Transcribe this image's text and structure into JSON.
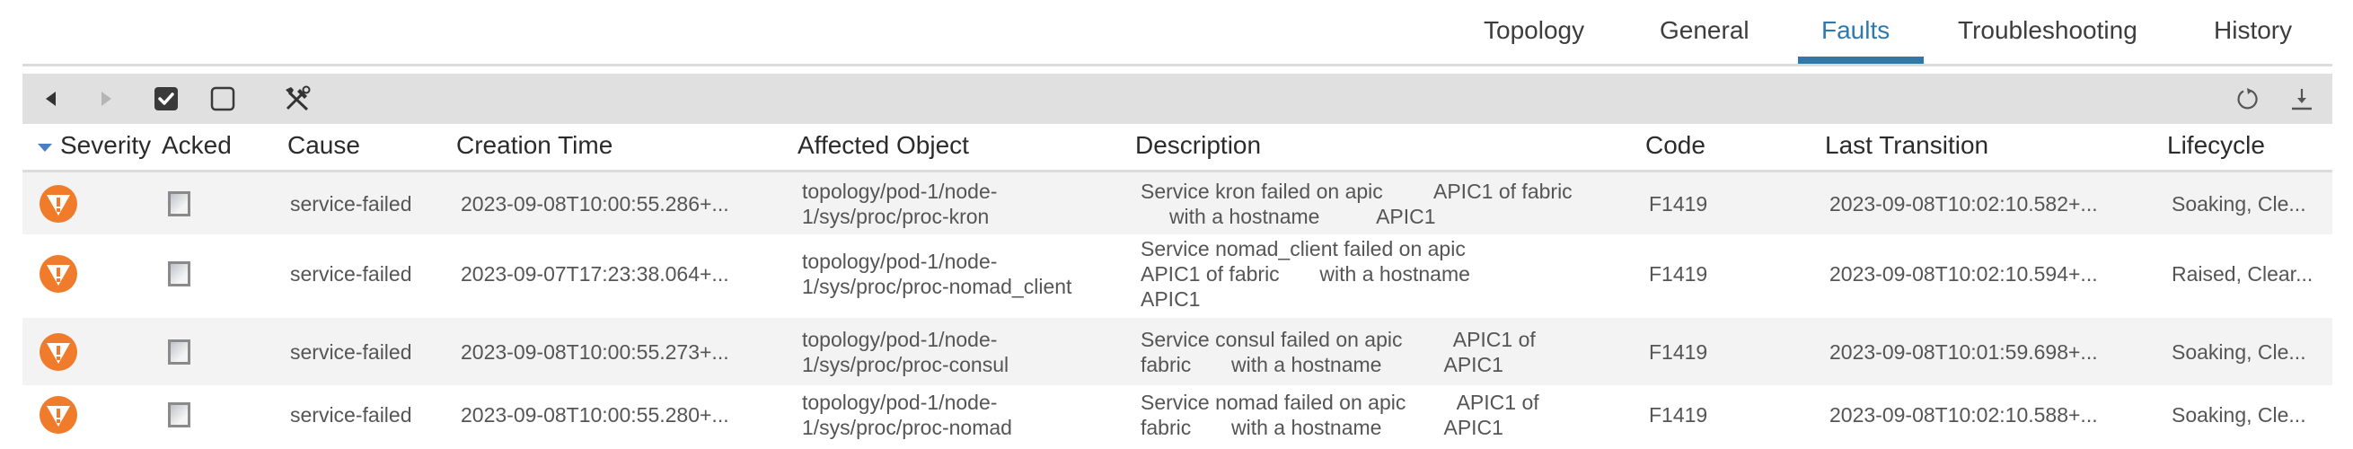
{
  "tabs": [
    {
      "label": "Topology",
      "active": false
    },
    {
      "label": "General",
      "active": false
    },
    {
      "label": "Faults",
      "active": true
    },
    {
      "label": "Troubleshooting",
      "active": false
    },
    {
      "label": "History",
      "active": false
    }
  ],
  "toolbar": {
    "left": [
      "previous-page-icon",
      "next-page-icon",
      "acknowledge-icon",
      "unacknowledge-icon",
      "tools-icon"
    ],
    "right": [
      "refresh-icon",
      "download-icon"
    ]
  },
  "colors": {
    "accent": "#2f78a8",
    "severity_major": "#f07b2a",
    "toolbar_bg": "#e0e0e0",
    "row_alt_bg": "#f3f3f3"
  },
  "table": {
    "sort_column": "Severity",
    "sort_direction": "descending",
    "columns": [
      "Severity",
      "Acked",
      "Cause",
      "Creation Time",
      "Affected Object",
      "Description",
      "Code",
      "Last Transition",
      "Lifecycle"
    ],
    "rows": [
      {
        "severity": "major",
        "acked": false,
        "cause": "service-failed",
        "creation_time": "2023-09-08T10:00:55.286+...",
        "affected_object": "topology/pod-1/node-\n1/sys/proc/proc-kron",
        "description": "Service kron failed on apic         APIC1 of fabric\n     with a hostname          APIC1",
        "code": "F1419",
        "last_transition": "2023-09-08T10:02:10.582+...",
        "lifecycle": "Soaking, Cle..."
      },
      {
        "severity": "major",
        "acked": false,
        "cause": "service-failed",
        "creation_time": "2023-09-07T17:23:38.064+...",
        "affected_object": "topology/pod-1/node-\n1/sys/proc/proc-nomad_client",
        "description": "Service nomad_client failed on apic\nAPIC1 of fabric       with a hostname\nAPIC1",
        "code": "F1419",
        "last_transition": "2023-09-08T10:02:10.594+...",
        "lifecycle": "Raised, Clear..."
      },
      {
        "severity": "major",
        "acked": false,
        "cause": "service-failed",
        "creation_time": "2023-09-08T10:00:55.273+...",
        "affected_object": "topology/pod-1/node-\n1/sys/proc/proc-consul",
        "description": "Service consul failed on apic         APIC1 of\nfabric       with a hostname           APIC1",
        "code": "F1419",
        "last_transition": "2023-09-08T10:01:59.698+...",
        "lifecycle": "Soaking, Cle..."
      },
      {
        "severity": "major",
        "acked": false,
        "cause": "service-failed",
        "creation_time": "2023-09-08T10:00:55.280+...",
        "affected_object": "topology/pod-1/node-\n1/sys/proc/proc-nomad",
        "description": "Service nomad failed on apic         APIC1 of\nfabric       with a hostname           APIC1",
        "code": "F1419",
        "last_transition": "2023-09-08T10:02:10.588+...",
        "lifecycle": "Soaking, Cle..."
      }
    ]
  }
}
